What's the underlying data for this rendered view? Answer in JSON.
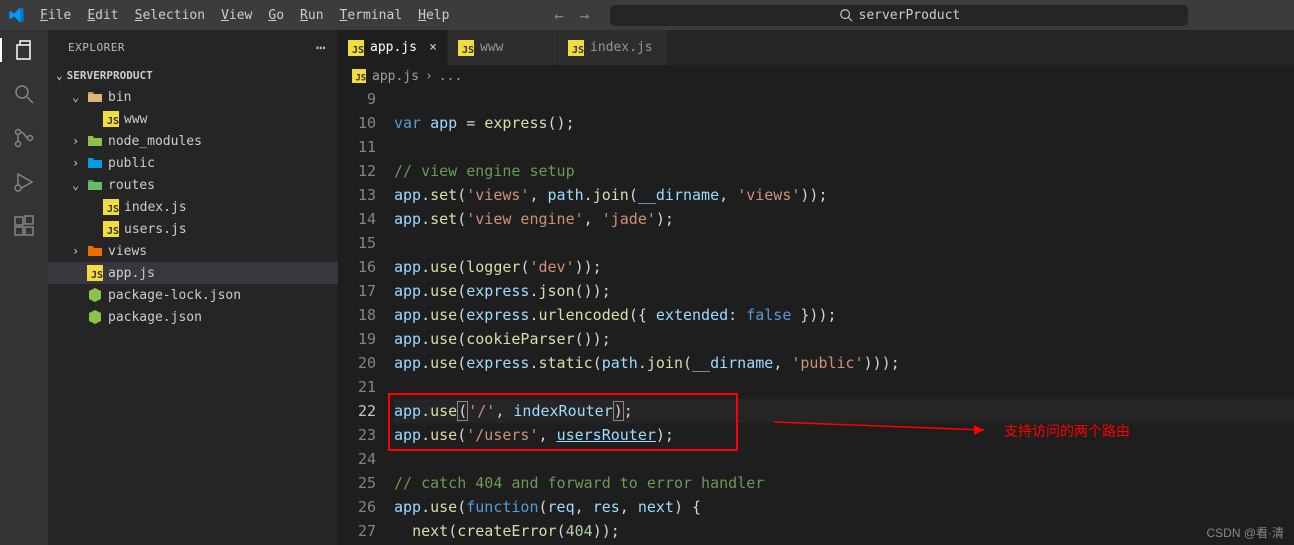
{
  "menu": {
    "file": "File",
    "edit": "Edit",
    "selection": "Selection",
    "view": "View",
    "go": "Go",
    "run": "Run",
    "terminal": "Terminal",
    "help": "Help"
  },
  "search": {
    "placeholder": "serverProduct"
  },
  "sidebar": {
    "title": "EXPLORER",
    "project": "SERVERPRODUCT",
    "tree": {
      "bin": "bin",
      "www": "www",
      "node_modules": "node_modules",
      "public": "public",
      "routes": "routes",
      "indexjs": "index.js",
      "usersjs": "users.js",
      "views": "views",
      "appjs": "app.js",
      "pkglock": "package-lock.json",
      "pkg": "package.json"
    }
  },
  "tabs": {
    "app": "app.js",
    "www": "www",
    "index": "index.js"
  },
  "breadcrumb": {
    "file": "app.js",
    "sep": "›",
    "more": "..."
  },
  "lines": {
    "start": 9,
    "current": 22
  },
  "code": {
    "l10_var": "var",
    "l10_app": "app",
    "l10_eq": " = ",
    "l10_express": "express",
    "l10_rest": "();",
    "l12": "// view engine setup",
    "l13_app": "app",
    "l13_set": "set",
    "l13_s1": "'views'",
    "l13_path": "path",
    "l13_join": "join",
    "l13_dir": "__dirname",
    "l13_s2": "'views'",
    "l14_s1": "'view engine'",
    "l14_s2": "'jade'",
    "l16_use": "use",
    "l16_logger": "logger",
    "l16_dev": "'dev'",
    "l17_json": "json",
    "l18_urlenc": "urlencoded",
    "l18_ext": "extended",
    "l18_false": "false",
    "l19_cookie": "cookieParser",
    "l20_static": "static",
    "l20_public": "'public'",
    "l22_root": "'/'",
    "l22_idx": "indexRouter",
    "l23_users": "'/users'",
    "l23_ur": "usersRouter",
    "l25": "// catch 404 and forward to error handler",
    "l26_func": "function",
    "l26_req": "req",
    "l26_res": "res",
    "l26_next": "next",
    "l27_next": "next",
    "l27_ce": "createError",
    "l27_404": "404"
  },
  "annotation": {
    "label": "支持访问的两个路由"
  },
  "watermark": "CSDN @看·清"
}
